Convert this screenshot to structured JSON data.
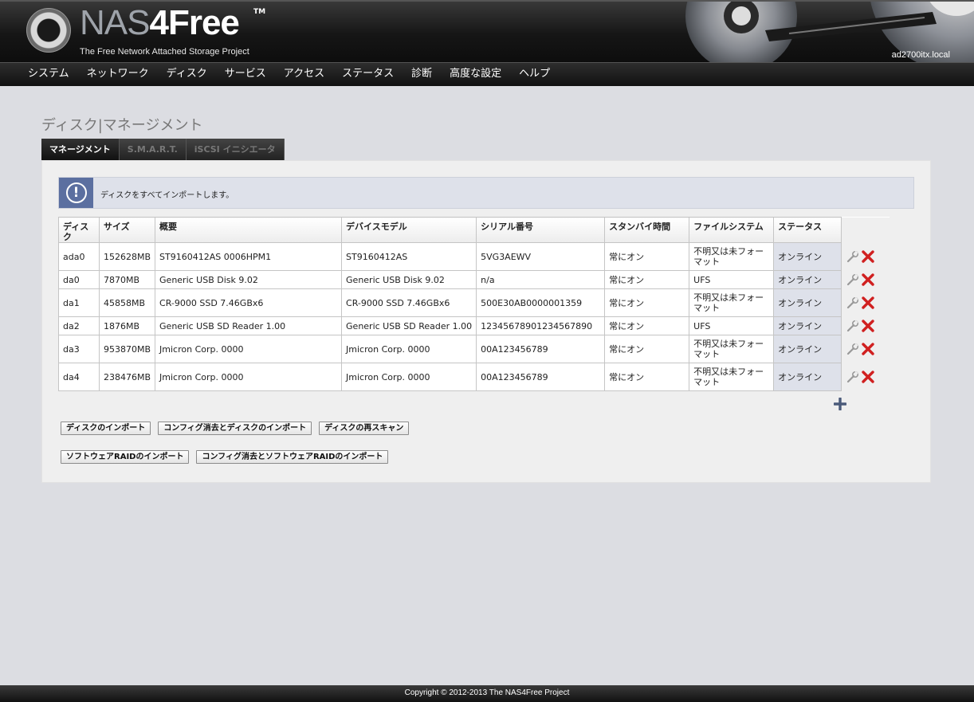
{
  "brand": {
    "logo_light": "NAS",
    "logo_bold": "4Free",
    "trademark": "TM",
    "tagline": "The Free Network Attached Storage Project",
    "hostname": "ad2700itx.local"
  },
  "nav": {
    "items": [
      "システム",
      "ネットワーク",
      "ディスク",
      "サービス",
      "アクセス",
      "ステータス",
      "診断",
      "高度な設定",
      "ヘルプ"
    ]
  },
  "page": {
    "title": "ディスク|マネージメント"
  },
  "tabs": [
    {
      "label": "マネージメント",
      "active": true
    },
    {
      "label": "S.M.A.R.T.",
      "active": false
    },
    {
      "label": "iSCSI イニシエータ",
      "active": false
    }
  ],
  "info": {
    "message": "ディスクをすべてインポートします。"
  },
  "table": {
    "headers": [
      "ディスク",
      "サイズ",
      "概要",
      "デバイスモデル",
      "シリアル番号",
      "スタンバイ時間",
      "ファイルシステム",
      "ステータス"
    ],
    "rows": [
      {
        "disk": "ada0",
        "size": "152628MB",
        "desc": "ST9160412AS 0006HPM1",
        "model": "ST9160412AS",
        "serial": "5VG3AEWV",
        "standby": "常にオン",
        "fs": "不明又は未フォーマット",
        "status": "オンライン"
      },
      {
        "disk": "da0",
        "size": "7870MB",
        "desc": "Generic USB Disk 9.02",
        "model": "Generic USB Disk 9.02",
        "serial": "n/a",
        "standby": "常にオン",
        "fs": "UFS",
        "status": "オンライン"
      },
      {
        "disk": "da1",
        "size": "45858MB",
        "desc": "CR-9000 SSD 7.46GBx6",
        "model": "CR-9000 SSD 7.46GBx6",
        "serial": "500E30AB0000001359",
        "standby": "常にオン",
        "fs": "不明又は未フォーマット",
        "status": "オンライン"
      },
      {
        "disk": "da2",
        "size": "1876MB",
        "desc": "Generic USB SD Reader 1.00",
        "model": "Generic USB SD Reader 1.00",
        "serial": "12345678901234567890",
        "standby": "常にオン",
        "fs": "UFS",
        "status": "オンライン"
      },
      {
        "disk": "da3",
        "size": "953870MB",
        "desc": "Jmicron Corp. 0000",
        "model": "Jmicron Corp. 0000",
        "serial": "00A123456789",
        "standby": "常にオン",
        "fs": "不明又は未フォーマット",
        "status": "オンライン"
      },
      {
        "disk": "da4",
        "size": "238476MB",
        "desc": "Jmicron Corp. 0000",
        "model": "Jmicron Corp. 0000",
        "serial": "00A123456789",
        "standby": "常にオン",
        "fs": "不明又は未フォーマット",
        "status": "オンライン"
      }
    ]
  },
  "buttons": {
    "import_disks": "ディスクのインポート",
    "clear_import_disks": "コンフィグ消去とディスクのインポート",
    "rescan_disks": "ディスクの再スキャン",
    "import_raid": "ソフトウェアRAIDのインポート",
    "clear_import_raid": "コンフィグ消去とソフトウェアRAIDのインポート"
  },
  "footer": {
    "copyright": "Copyright © 2012-2013 The NAS4Free Project"
  },
  "colors": {
    "accent": "#5b6fa0",
    "status_bg": "#dee1ea",
    "delete_red": "#d02020"
  }
}
